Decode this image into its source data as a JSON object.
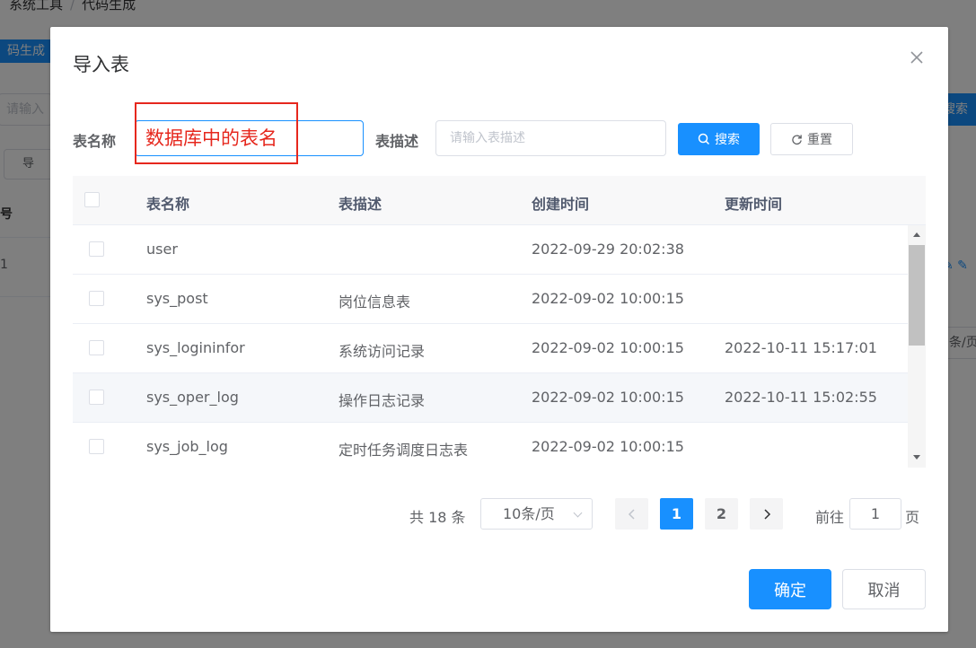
{
  "background": {
    "breadcrumb": [
      "系统工具",
      "代码生成"
    ],
    "tag_label": "码生成",
    "input_placeholder": "请输入",
    "import_btn": "导",
    "table_header": "号",
    "row_value": "1",
    "search_btn": "搜索",
    "pagesize": "条/页"
  },
  "dialog": {
    "title": "导入表",
    "filters": {
      "table_name_label": "表名称",
      "table_name_value": "",
      "table_desc_label": "表描述",
      "table_desc_placeholder": "请输入表描述",
      "search_label": "搜索",
      "reset_label": "重置"
    },
    "annotation": "数据库中的表名",
    "table": {
      "columns": [
        "表名称",
        "表描述",
        "创建时间",
        "更新时间"
      ],
      "rows": [
        {
          "name": "user",
          "desc": "",
          "created": "2022-09-29 20:02:38",
          "updated": ""
        },
        {
          "name": "sys_post",
          "desc": "岗位信息表",
          "created": "2022-09-02 10:00:15",
          "updated": ""
        },
        {
          "name": "sys_logininfor",
          "desc": "系统访问记录",
          "created": "2022-09-02 10:00:15",
          "updated": "2022-10-11 15:17:01"
        },
        {
          "name": "sys_oper_log",
          "desc": "操作日志记录",
          "created": "2022-09-02 10:00:15",
          "updated": "2022-10-11 15:02:55"
        },
        {
          "name": "sys_job_log",
          "desc": "定时任务调度日志表",
          "created": "2022-09-02 10:00:15",
          "updated": ""
        }
      ]
    },
    "pagination": {
      "total_text": "共 18 条",
      "page_size": "10条/页",
      "pages": [
        "1",
        "2"
      ],
      "current_page": "1",
      "goto_label": "前往",
      "goto_value": "1",
      "goto_suffix": "页"
    },
    "confirm_label": "确定",
    "cancel_label": "取消"
  },
  "colors": {
    "primary": "#1890ff",
    "annotation": "#e6271d",
    "overlay": "#000000"
  }
}
